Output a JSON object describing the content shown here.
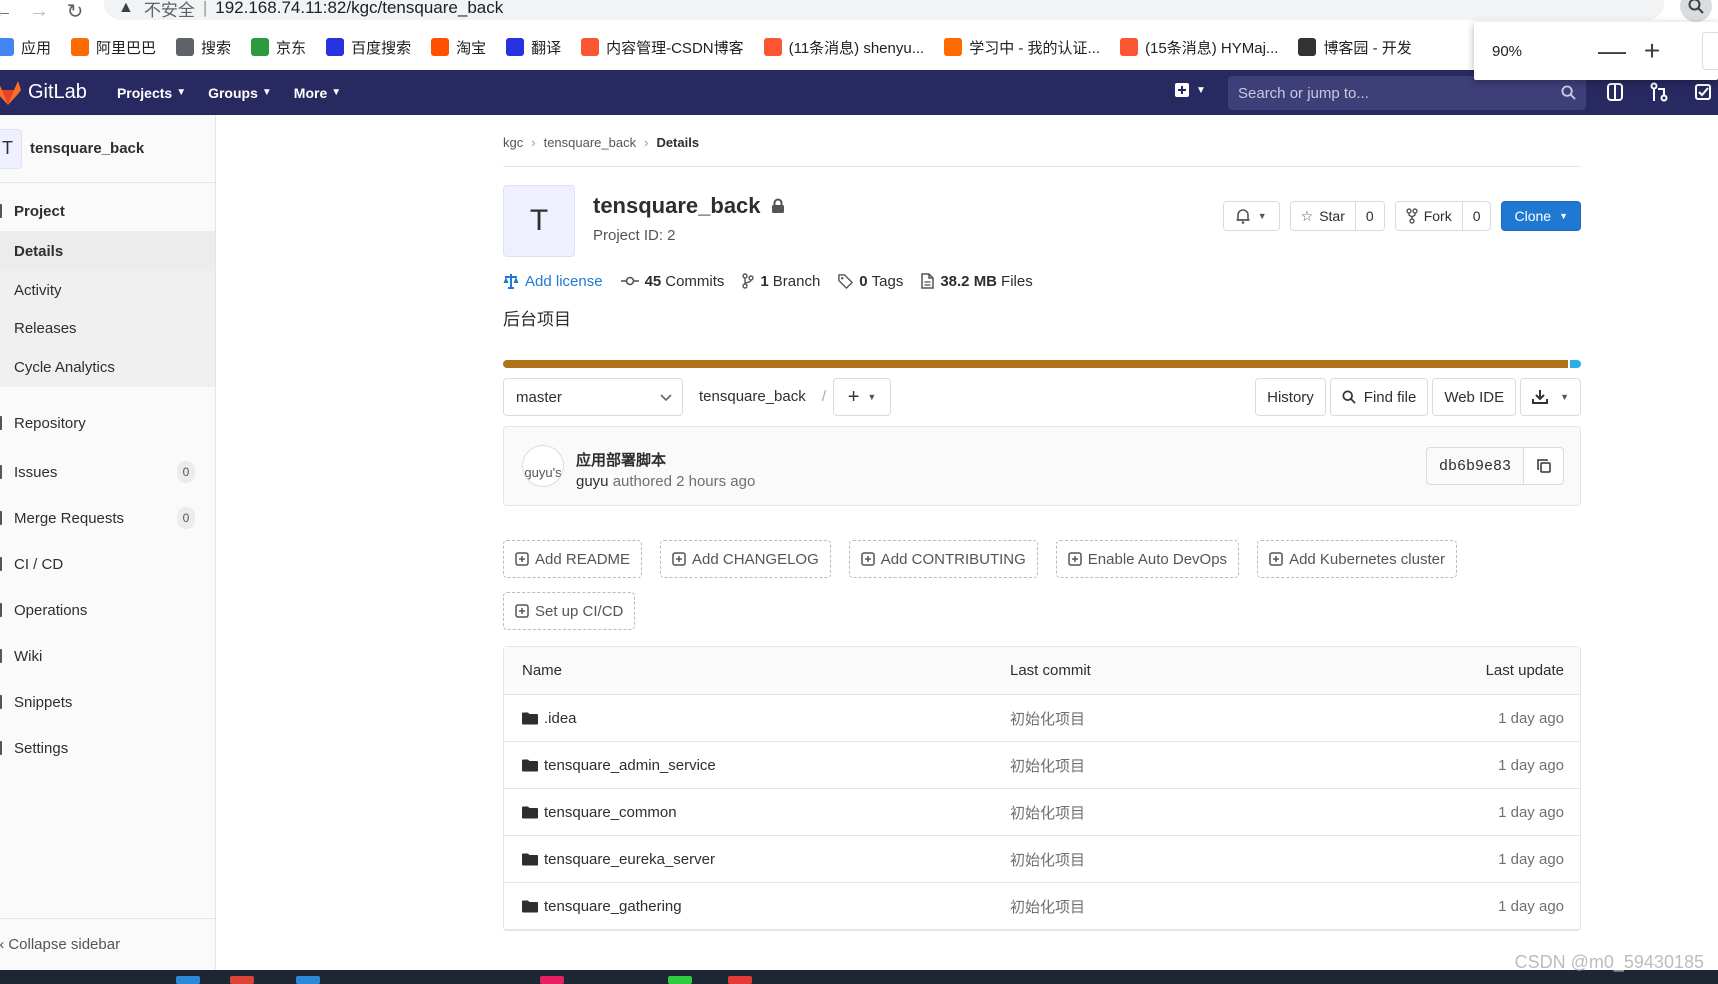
{
  "browser": {
    "insecure_label": "不安全",
    "url": "192.168.74.11:82/kgc/tensquare_back",
    "zoom_value": "90%",
    "zoom_minus": "—",
    "zoom_plus": "+",
    "bookmarks": [
      {
        "label": "应用",
        "color": "#4285f4"
      },
      {
        "label": "阿里巴巴",
        "color": "#ff6a00"
      },
      {
        "label": "搜索",
        "color": "#5f6368"
      },
      {
        "label": "京东",
        "color": "#2e9a3e"
      },
      {
        "label": "百度搜索",
        "color": "#2932e1"
      },
      {
        "label": "淘宝",
        "color": "#ff5000"
      },
      {
        "label": "翻译",
        "color": "#2932e1"
      },
      {
        "label": "内容管理-CSDN博客",
        "color": "#fc5531"
      },
      {
        "label": "(11条消息) shenyu...",
        "color": "#fc5531"
      },
      {
        "label": "学习中 - 我的认证...",
        "color": "#ff6a00"
      },
      {
        "label": "(15条消息) HYMaj...",
        "color": "#fc5531"
      },
      {
        "label": "博客园 - 开发",
        "color": "#333333"
      }
    ]
  },
  "topnav": {
    "brand": "GitLab",
    "menus": [
      "Projects",
      "Groups",
      "More"
    ],
    "search_placeholder": "Search or jump to..."
  },
  "sidebar": {
    "avatar_letter": "T",
    "project_name": "tensquare_back",
    "project_section": "Project",
    "project_items": [
      "Details",
      "Activity",
      "Releases",
      "Cycle Analytics"
    ],
    "items": [
      {
        "label": "Repository",
        "badge": ""
      },
      {
        "label": "Issues",
        "badge": "0"
      },
      {
        "label": "Merge Requests",
        "badge": "0"
      },
      {
        "label": "CI / CD",
        "badge": ""
      },
      {
        "label": "Operations",
        "badge": ""
      },
      {
        "label": "Wiki",
        "badge": ""
      },
      {
        "label": "Snippets",
        "badge": ""
      },
      {
        "label": "Settings",
        "badge": ""
      }
    ],
    "collapse_label": "Collapse sidebar"
  },
  "breadcrumb": [
    "kgc",
    "tensquare_back",
    "Details"
  ],
  "project": {
    "avatar_letter": "T",
    "title": "tensquare_back",
    "id_label": "Project ID: 2",
    "star_label": "Star",
    "star_count": "0",
    "fork_label": "Fork",
    "fork_count": "0",
    "clone_label": "Clone",
    "add_license": "Add license",
    "commits_count": "45",
    "commits_label": "Commits",
    "branch_count": "1",
    "branch_label": "Branch",
    "tags_count": "0",
    "tags_label": "Tags",
    "files_size": "38.2 MB",
    "files_label": "Files",
    "description": "后台项目",
    "lang_primary_fraction": 0.99
  },
  "tree": {
    "branch": "master",
    "path": "tensquare_back",
    "slash": "/",
    "history": "History",
    "find_file": "Find file",
    "web_ide": "Web IDE"
  },
  "last_commit": {
    "avatar_alt": "guyu's",
    "title": "应用部署脚本",
    "author": "guyu",
    "meta": "authored 2 hours ago",
    "sha": "db6b9e83"
  },
  "add_buttons": [
    "Add README",
    "Add CHANGELOG",
    "Add CONTRIBUTING",
    "Enable Auto DevOps",
    "Add Kubernetes cluster",
    "Set up CI/CD"
  ],
  "files": {
    "headers": {
      "name": "Name",
      "commit": "Last commit",
      "update": "Last update"
    },
    "rows": [
      {
        "name": ".idea",
        "commit": "初始化项目",
        "update": "1 day ago"
      },
      {
        "name": "tensquare_admin_service",
        "commit": "初始化项目",
        "update": "1 day ago"
      },
      {
        "name": "tensquare_common",
        "commit": "初始化项目",
        "update": "1 day ago"
      },
      {
        "name": "tensquare_eureka_server",
        "commit": "初始化项目",
        "update": "1 day ago"
      },
      {
        "name": "tensquare_gathering",
        "commit": "初始化项目",
        "update": "1 day ago"
      }
    ]
  },
  "watermark": "CSDN @m0_59430185",
  "colors": {
    "nav_bg": "#292961",
    "accent": "#1f78d1",
    "lang_java": "#b07219",
    "lang_other": "#29b0e8"
  }
}
